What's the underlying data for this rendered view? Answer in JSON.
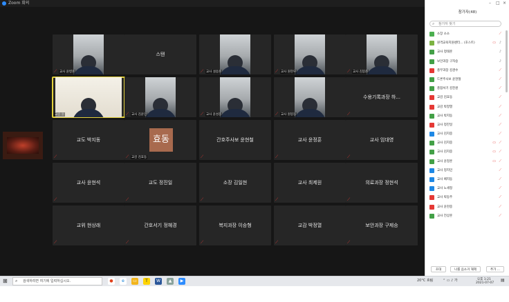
{
  "window": {
    "title": "Zoom 회의"
  },
  "stage": {
    "side_thumb": "",
    "tiles": [
      {
        "name": "교사 윤병훈",
        "type": "video",
        "muted": true
      },
      {
        "name": "스탠",
        "type": "name",
        "muted": false
      },
      {
        "name": "교사 설승훈",
        "type": "video",
        "muted": true
      },
      {
        "name": "교사 원현우",
        "type": "video",
        "muted": true
      },
      {
        "name": "교사 김봉준",
        "type": "video",
        "muted": true
      },
      {
        "name": "교감 원",
        "type": "video",
        "muted": false,
        "active": true
      },
      {
        "name": "교사 김윤민",
        "type": "video",
        "muted": true
      },
      {
        "name": "교사 윤성종",
        "type": "video",
        "muted": true
      },
      {
        "name": "교사 원봉동",
        "type": "video",
        "muted": true
      },
      {
        "name": "수용기록과장 하...",
        "type": "name",
        "muted": true
      },
      {
        "name": "교도 박지동",
        "type": "name",
        "muted": true
      },
      {
        "name": "교감 김효동",
        "type": "avatar",
        "avatar_text": "효동",
        "muted": true
      },
      {
        "name": "간호주사보 윤현철",
        "type": "name",
        "muted": true
      },
      {
        "name": "교사 윤정훈",
        "type": "name",
        "muted": true
      },
      {
        "name": "교사 임대영",
        "type": "name",
        "muted": true
      },
      {
        "name": "교사 윤현석",
        "type": "name",
        "muted": true
      },
      {
        "name": "교도 정진일",
        "type": "name",
        "muted": true
      },
      {
        "name": "소장 김일현",
        "type": "name",
        "muted": true
      },
      {
        "name": "교사 최제원",
        "type": "name",
        "muted": true
      },
      {
        "name": "의료과장 정현석",
        "type": "name",
        "muted": true
      },
      {
        "name": "교위 현상래",
        "type": "name",
        "muted": true
      },
      {
        "name": "간호서기 정혜경",
        "type": "name",
        "muted": true
      },
      {
        "name": "복지과장 이승형",
        "type": "name",
        "muted": true
      },
      {
        "name": "교감 박정열",
        "type": "name",
        "muted": true
      },
      {
        "name": "보안과장 구제승",
        "type": "name",
        "muted": true
      }
    ]
  },
  "panel": {
    "title": "참가자(48)",
    "search_placeholder": "참가자 찾기",
    "participants": [
      {
        "name": "소장 소소",
        "color": "#4caf50",
        "mic": "muted",
        "cam": false
      },
      {
        "name": "원격교육지원센터... (호스트)",
        "color": "#7cb342",
        "mic": "on",
        "cam": true
      },
      {
        "name": "교사 정태훈",
        "color": "#43a047",
        "mic": "on",
        "cam": false
      },
      {
        "name": "보안과장 구자승",
        "color": "#43a047",
        "mic": "on",
        "cam": false
      },
      {
        "name": "총무과장 김경수",
        "color": "#e53935",
        "mic": "muted",
        "cam": false
      },
      {
        "name": "드론주사보 윤현철",
        "color": "#43a047",
        "mic": "muted",
        "cam": false
      },
      {
        "name": "총합서기 김진원",
        "color": "#43a047",
        "mic": "muted",
        "cam": false
      },
      {
        "name": "교감 김효동",
        "color": "#e53935",
        "mic": "muted",
        "cam": false
      },
      {
        "name": "교감 박정열",
        "color": "#e53935",
        "mic": "muted",
        "cam": false
      },
      {
        "name": "교사 박지동",
        "color": "#43a047",
        "mic": "muted",
        "cam": false
      },
      {
        "name": "교사 정진일",
        "color": "#e53935",
        "mic": "muted",
        "cam": false
      },
      {
        "name": "교사 김지중",
        "color": "#1e88e5",
        "mic": "muted",
        "cam": false
      },
      {
        "name": "교사 김지중",
        "color": "#43a047",
        "mic": "muted",
        "cam": true
      },
      {
        "name": "교사 김지중",
        "color": "#43a047",
        "mic": "muted",
        "cam": true
      },
      {
        "name": "교사 윤정훈",
        "color": "#43a047",
        "mic": "muted",
        "cam": true
      },
      {
        "name": "교사 정지민",
        "color": "#1e88e5",
        "mic": "muted",
        "cam": false
      },
      {
        "name": "교사 배지동",
        "color": "#1e88e5",
        "mic": "muted",
        "cam": false
      },
      {
        "name": "교사 노세정",
        "color": "#1e88e5",
        "mic": "muted",
        "cam": false
      },
      {
        "name": "교사 박동주",
        "color": "#e53935",
        "mic": "muted",
        "cam": false
      },
      {
        "name": "교사 윤현중",
        "color": "#e53935",
        "mic": "muted",
        "cam": false
      },
      {
        "name": "교사 전상훈",
        "color": "#43a047",
        "mic": "muted",
        "cam": false
      }
    ],
    "footer": {
      "invite": "초대",
      "mute_all": "나를 음소거 해제",
      "more": "추가 ..."
    }
  },
  "taskbar": {
    "search_placeholder": "검색하려면 여기에 입력하십시오.",
    "weather": "20°C 흐림",
    "clock_time": "오후 1:21",
    "clock_date": "2021-07-07"
  }
}
